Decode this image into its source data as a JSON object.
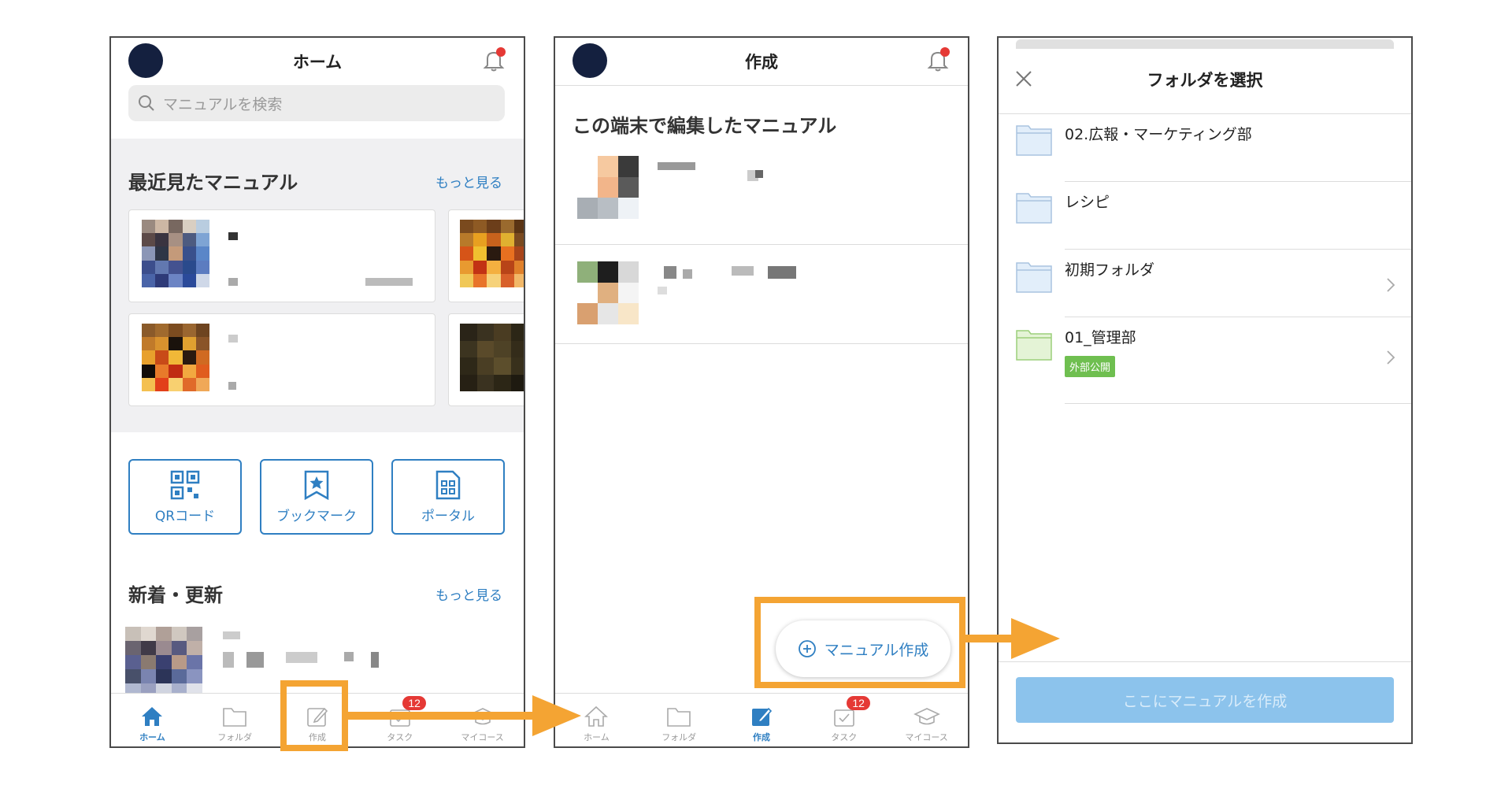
{
  "colors": {
    "accent": "#2f7fc2",
    "highlight": "#f4a433",
    "badge": "#e53935",
    "tag": "#6fbf50",
    "disabled_button": "#8cc3ec"
  },
  "screen1": {
    "title": "ホーム",
    "search_placeholder": "マニュアルを検索",
    "recent": {
      "title": "最近見たマニュアル",
      "more": "もっと見る"
    },
    "quick": [
      {
        "label": "QRコード",
        "icon": "qr-code-icon"
      },
      {
        "label": "ブックマーク",
        "icon": "bookmark-icon"
      },
      {
        "label": "ポータル",
        "icon": "portal-icon"
      }
    ],
    "news": {
      "title": "新着・更新",
      "more": "もっと見る"
    },
    "tabs": [
      {
        "label": "ホーム",
        "icon": "home-icon"
      },
      {
        "label": "フォルダ",
        "icon": "folder-icon"
      },
      {
        "label": "作成",
        "icon": "edit-icon"
      },
      {
        "label": "タスク",
        "icon": "task-icon",
        "badge": "12"
      },
      {
        "label": "マイコース",
        "icon": "graduation-cap-icon"
      }
    ]
  },
  "screen2": {
    "title": "作成",
    "section_title": "この端末で編集したマニュアル",
    "fab_label": "マニュアル作成",
    "tabs": [
      {
        "label": "ホーム",
        "icon": "home-icon"
      },
      {
        "label": "フォルダ",
        "icon": "folder-icon"
      },
      {
        "label": "作成",
        "icon": "edit-icon"
      },
      {
        "label": "タスク",
        "icon": "task-icon",
        "badge": "12"
      },
      {
        "label": "マイコース",
        "icon": "graduation-cap-icon"
      }
    ]
  },
  "screen3": {
    "title": "フォルダを選択",
    "folders": [
      {
        "name": "02.広報・マーケティング部"
      },
      {
        "name": "レシピ"
      },
      {
        "name": "初期フォルダ"
      },
      {
        "name": "01_管理部",
        "tag": "外部公開"
      }
    ],
    "create_label": "ここにマニュアルを作成"
  }
}
